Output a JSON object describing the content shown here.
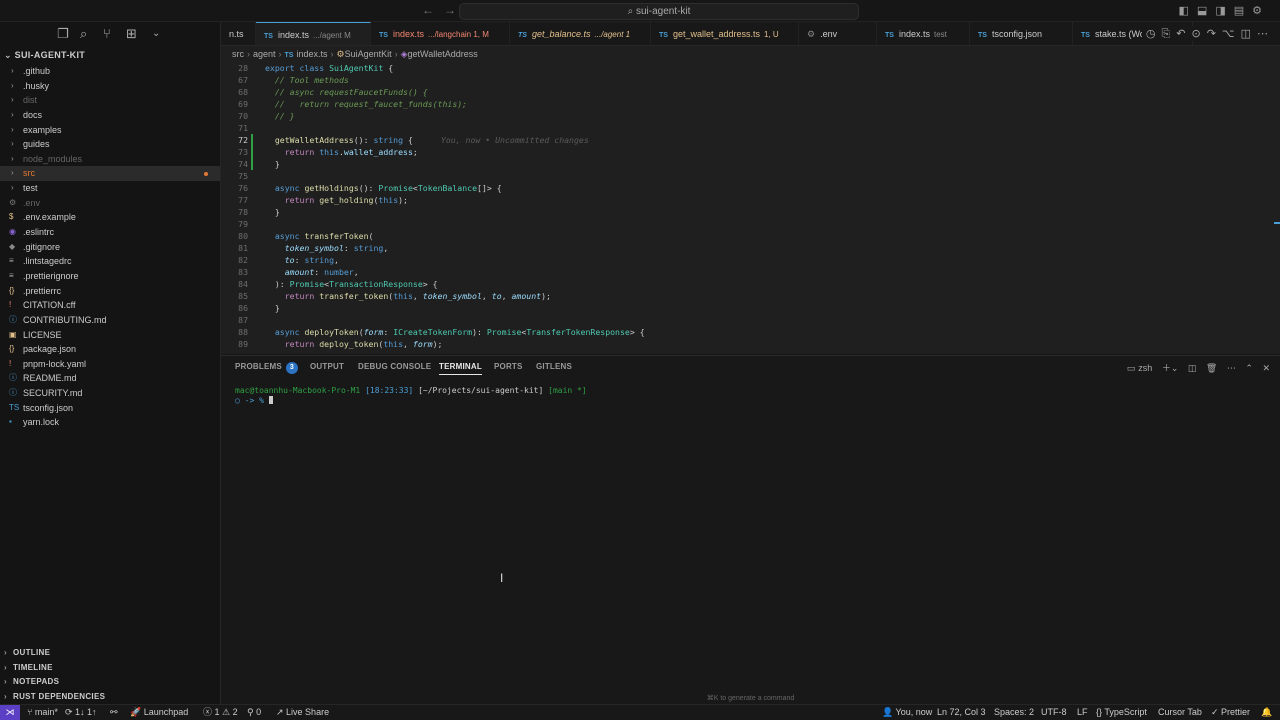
{
  "titlebar": {
    "command_center": "sui-agent-kit"
  },
  "sidebar": {
    "title": "SUI-AGENT-KIT",
    "items": [
      {
        "label": ".github",
        "kind": "folder",
        "dim": false
      },
      {
        "label": ".husky",
        "kind": "folder",
        "dim": false
      },
      {
        "label": "dist",
        "kind": "folder",
        "dim": true
      },
      {
        "label": "docs",
        "kind": "folder",
        "dim": false
      },
      {
        "label": "examples",
        "kind": "folder",
        "dim": false
      },
      {
        "label": "guides",
        "kind": "folder",
        "dim": false
      },
      {
        "label": "node_modules",
        "kind": "folder",
        "dim": true
      },
      {
        "label": "src",
        "kind": "folder",
        "dim": false,
        "active": true
      },
      {
        "label": "test",
        "kind": "folder",
        "dim": false
      },
      {
        "label": ".env",
        "kind": "file",
        "icon": "⚙",
        "icon_color": "#777777",
        "dim": true
      },
      {
        "label": ".env.example",
        "kind": "file",
        "icon": "$",
        "icon_color": "#e2c08d",
        "dim": false
      },
      {
        "label": ".eslintrc",
        "kind": "file",
        "icon": "◉",
        "icon_color": "#8a63d2",
        "dim": false
      },
      {
        "label": ".gitignore",
        "kind": "file",
        "icon": "◆",
        "icon_color": "#888888",
        "dim": false
      },
      {
        "label": ".lintstagedrc",
        "kind": "file",
        "icon": "≡",
        "icon_color": "#aaaaaa",
        "dim": false
      },
      {
        "label": ".prettierignore",
        "kind": "file",
        "icon": "≡",
        "icon_color": "#aaaaaa",
        "dim": false
      },
      {
        "label": ".prettierrc",
        "kind": "file",
        "icon": "{}",
        "icon_color": "#e2c08d",
        "dim": false
      },
      {
        "label": "CITATION.cff",
        "kind": "file",
        "icon": "!",
        "icon_color": "#f48771",
        "dim": false
      },
      {
        "label": "CONTRIBUTING.md",
        "kind": "file",
        "icon": "ⓘ",
        "icon_color": "#4a9fd6",
        "dim": false
      },
      {
        "label": "LICENSE",
        "kind": "file",
        "icon": "▣",
        "icon_color": "#e2c08d",
        "dim": false
      },
      {
        "label": "package.json",
        "kind": "file",
        "icon": "{}",
        "icon_color": "#e2c08d",
        "dim": false
      },
      {
        "label": "pnpm-lock.yaml",
        "kind": "file",
        "icon": "!",
        "icon_color": "#f48771",
        "dim": false
      },
      {
        "label": "README.md",
        "kind": "file",
        "icon": "ⓘ",
        "icon_color": "#4a9fd6",
        "dim": false
      },
      {
        "label": "SECURITY.md",
        "kind": "file",
        "icon": "ⓘ",
        "icon_color": "#4a9fd6",
        "dim": false
      },
      {
        "label": "tsconfig.json",
        "kind": "file",
        "icon": "TS",
        "icon_color": "#4a9fd6",
        "dim": false
      },
      {
        "label": "yarn.lock",
        "kind": "file",
        "icon": "▪",
        "icon_color": "#4a9fd6",
        "dim": false
      }
    ],
    "sections": [
      "OUTLINE",
      "TIMELINE",
      "NOTEPADS",
      "RUST DEPENDENCIES"
    ]
  },
  "tabs": [
    {
      "label": "n.ts",
      "desc": ""
    },
    {
      "label": "index.ts",
      "desc": ".../agent M",
      "active": true
    },
    {
      "label": "index.ts",
      "desc": ".../langchain 1, M",
      "style": "err"
    },
    {
      "label": "get_balance.ts",
      "desc": ".../agent 1",
      "style": "mod"
    },
    {
      "label": "get_wallet_address.ts",
      "desc": "1, U",
      "style": "mod"
    },
    {
      "label": ".env",
      "desc": ""
    },
    {
      "label": "index.ts",
      "desc": "test"
    },
    {
      "label": "tsconfig.json",
      "desc": ""
    },
    {
      "label": "stake.ts (Wor",
      "desc": ""
    }
  ],
  "breadcrumbs": [
    "src",
    "agent",
    "index.ts",
    "SuiAgentKit",
    "getWalletAddress"
  ],
  "editor": {
    "blame": "You, now • Uncommitted changes",
    "line_numbers": [
      "28",
      "67",
      "68",
      "69",
      "70",
      "71",
      "72",
      "73",
      "74",
      "75",
      "76",
      "77",
      "78",
      "79",
      "80",
      "81",
      "82",
      "83",
      "84",
      "85",
      "86",
      "87",
      "88",
      "89"
    ]
  },
  "panel": {
    "tabs": [
      "PROBLEMS",
      "OUTPUT",
      "DEBUG CONSOLE",
      "TERMINAL",
      "PORTS",
      "GITLENS"
    ],
    "problems_count": "3",
    "shell": "zsh",
    "terminal": {
      "user": "mac@toannhu-Macbook-Pro-M1",
      "time": "[18:23:33]",
      "path": "[~/Projects/sui-agent-kit]",
      "branch": "[main *]",
      "prompt": "○ -> %"
    },
    "hint": "⌘K to generate a command"
  },
  "statusbar": {
    "branch": "main*",
    "sync": "1↓ 1↑",
    "launchpad": "Launchpad",
    "errors": "1",
    "warnings": "2",
    "ports": "0",
    "liveshare": "Live Share",
    "blame": "You, now",
    "position": "Ln 72, Col 3",
    "spaces": "Spaces: 2",
    "encoding": "UTF-8",
    "eol": "LF",
    "language": "TypeScript",
    "cursor_tab": "Cursor Tab",
    "prettier": "Prettier"
  },
  "colors": {
    "accent": "#4a9fd6",
    "git_added": "#2ea043",
    "modified": "#e2c08d",
    "error": "#f48771",
    "remote": "#5b3fc4"
  }
}
